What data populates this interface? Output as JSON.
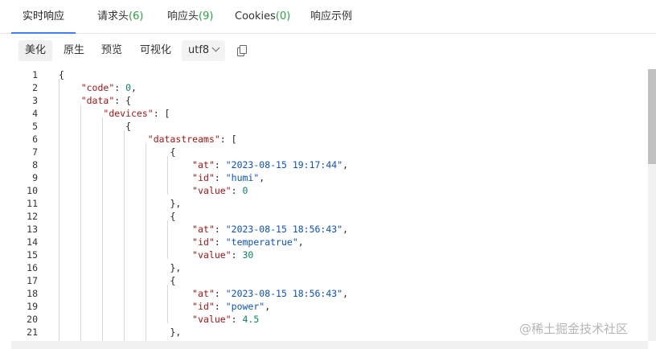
{
  "tabs": [
    {
      "label": "实时响应",
      "count": ""
    },
    {
      "label": "请求头",
      "count": "(6)"
    },
    {
      "label": "响应头",
      "count": "(9)"
    },
    {
      "label": "Cookies",
      "count": "(0)"
    },
    {
      "label": "响应示例",
      "count": ""
    }
  ],
  "toolbar": {
    "beautify": "美化",
    "raw": "原生",
    "preview": "预览",
    "visualize": "可视化",
    "encoding": "utf8"
  },
  "code_lines": [
    "{",
    "    \"code\": 0,",
    "    \"data\": {",
    "        \"devices\": [",
    "            {",
    "                \"datastreams\": [",
    "                    {",
    "                        \"at\": \"2023-08-15 19:17:44\",",
    "                        \"id\": \"humi\",",
    "                        \"value\": 0",
    "                    },",
    "                    {",
    "                        \"at\": \"2023-08-15 18:56:43\",",
    "                        \"id\": \"temperatrue\",",
    "                        \"value\": 30",
    "                    },",
    "                    {",
    "                        \"at\": \"2023-08-15 18:56:43\",",
    "                        \"id\": \"power\",",
    "                        \"value\": 4.5",
    "                    },"
  ],
  "watermark": "@稀土掘金技术社区",
  "colors": {
    "accent": "#3c7ff5",
    "count": "#2aa147",
    "json_key": "#a31515",
    "json_string": "#0b51c5",
    "json_number": "#098658"
  }
}
